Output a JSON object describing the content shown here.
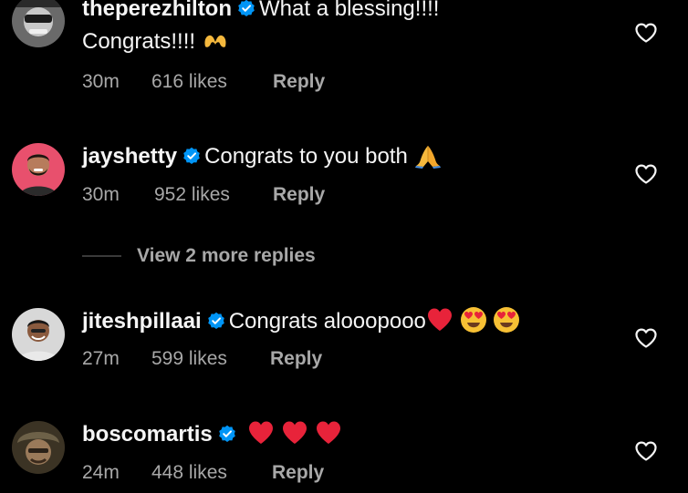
{
  "comments": [
    {
      "username": "theperezhilton",
      "text_line1": "What a blessing!!!!",
      "text_line2": "Congrats!!!!",
      "emoji": [
        "heart-hands"
      ],
      "time": "30m",
      "likes": "616 likes",
      "reply": "Reply"
    },
    {
      "username": "jayshetty",
      "text": "Congrats to you both",
      "emoji": [
        "folded-hands"
      ],
      "time": "30m",
      "likes": "952 likes",
      "reply": "Reply"
    },
    {
      "username": "jiteshpillaai",
      "text": "Congrats alooopooo",
      "emoji": [
        "red-heart",
        "heart-eyes",
        "heart-eyes"
      ],
      "time": "27m",
      "likes": "599 likes",
      "reply": "Reply"
    },
    {
      "username": "boscomartis",
      "text": "",
      "emoji": [
        "red-heart",
        "red-heart",
        "red-heart"
      ],
      "time": "24m",
      "likes": "448 likes",
      "reply": "Reply"
    }
  ],
  "view_more_replies": "View 2 more replies",
  "icons": {
    "verified": "verified-badge-icon",
    "like": "heart-outline-icon"
  },
  "colors": {
    "background": "#000000",
    "primary_text": "#f5f5f5",
    "secondary_text": "#a8a8a8",
    "verified": "#0095f6"
  }
}
